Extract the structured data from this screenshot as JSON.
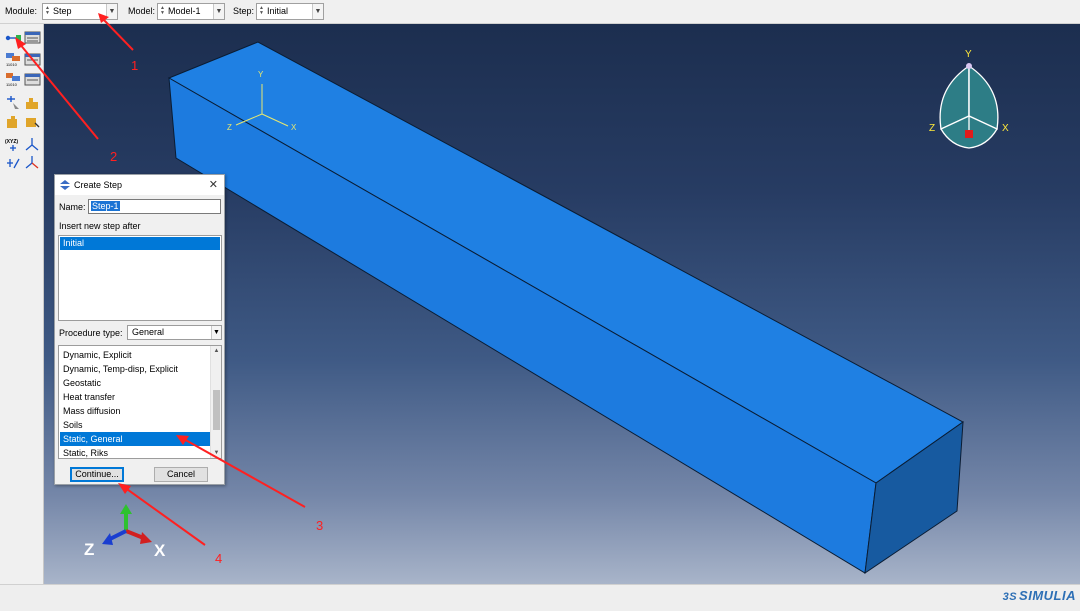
{
  "context_bar": {
    "module_label": "Module:",
    "module_value": "Step",
    "model_label": "Model:",
    "model_value": "Model-1",
    "step_label": "Step:",
    "step_value": "Initial"
  },
  "toolbox": {
    "icons": [
      "step-create-icon",
      "step-manager-icon",
      "field-output-request-icon",
      "field-output-manager-icon",
      "history-output-request-icon",
      "history-output-manager-icon",
      "adaptive-remesh-icon",
      "controls-icon",
      "ale-adaptive-mesh-icon",
      "solver-controls-icon",
      "datum-point-icon",
      "datum-axis-icon",
      "datum-plane-icon",
      "datum-csys-icon"
    ]
  },
  "viewport": {
    "part_color": "#1e7fe0",
    "part_dark_color": "#175aa0",
    "local_triad": {
      "y": "Y",
      "x": "X",
      "z": "Z"
    },
    "view_cube": {
      "y": "Y",
      "z": "Z",
      "x": "X"
    },
    "global_triad": {
      "z": "Z",
      "x": "X"
    }
  },
  "dialog": {
    "title": "Create Step",
    "name_label": "Name:",
    "name_value": "Step-1",
    "insert_label": "Insert new step after",
    "insert_items": [
      "Initial"
    ],
    "procedure_label": "Procedure type:",
    "procedure_value": "General",
    "procedures": [
      "Dynamic, Explicit",
      "Dynamic, Temp-disp, Explicit",
      "Geostatic",
      "Heat transfer",
      "Mass diffusion",
      "Soils",
      "Static, General",
      "Static, Riks"
    ],
    "selected_procedure": "Static, General",
    "continue_label": "Continue...",
    "cancel_label": "Cancel"
  },
  "annotations": {
    "color": "#ff2020",
    "labels": [
      "1",
      "2",
      "3",
      "4"
    ]
  },
  "branding": {
    "logo_text": "SIMULIA"
  }
}
